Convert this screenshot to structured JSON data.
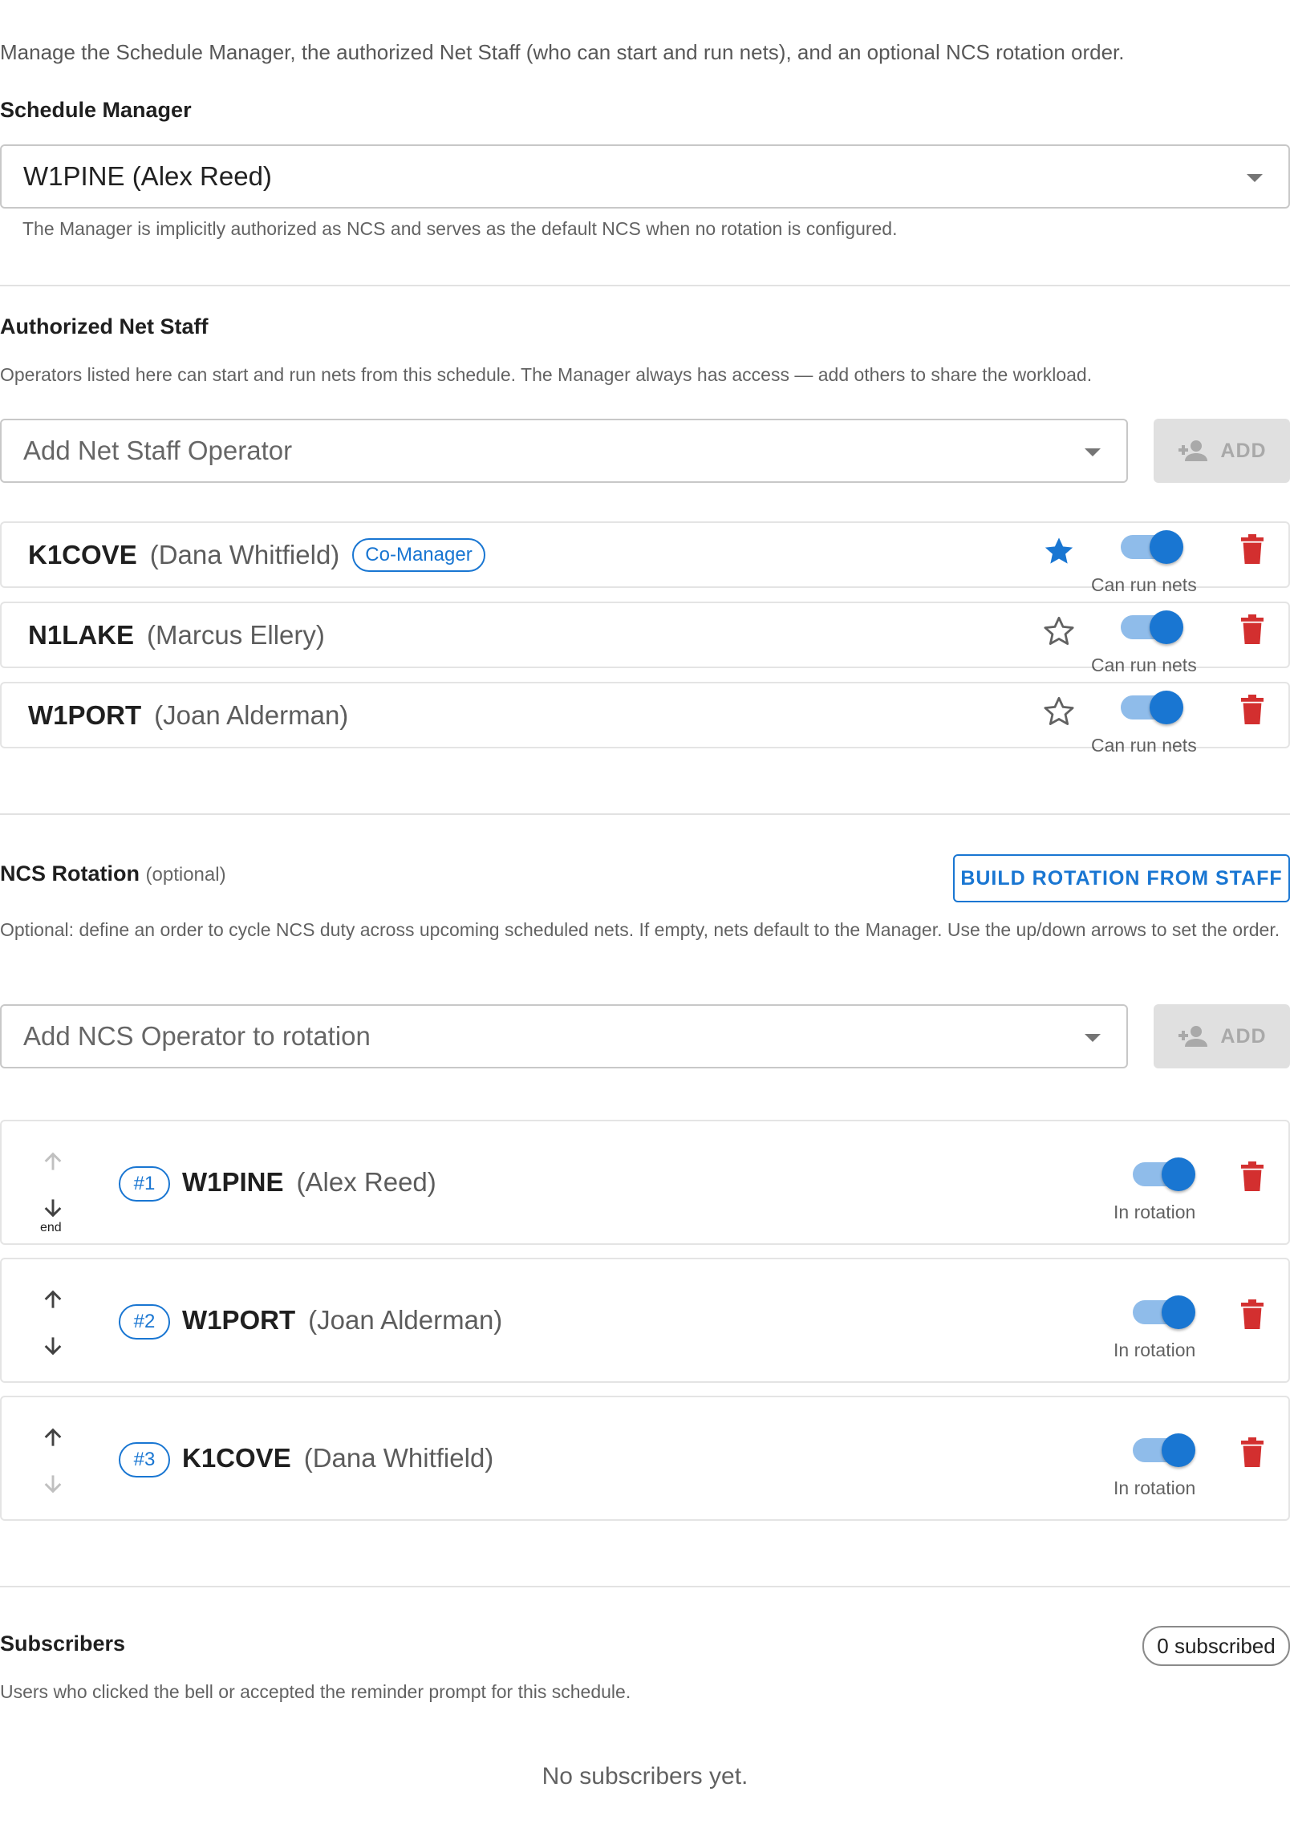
{
  "intro": "Manage the Schedule Manager, the authorized Net Staff (who can start and run nets), and an optional NCS rotation order.",
  "manager": {
    "title": "Schedule Manager",
    "selected": "W1PINE (Alex Reed)",
    "helper": "The Manager is implicitly authorized as NCS and serves as the default NCS when no rotation is configured."
  },
  "staff": {
    "title": "Authorized Net Staff",
    "description": "Operators listed here can start and run nets from this schedule. The Manager always has access — add others to share the workload.",
    "add_placeholder": "Add Net Staff Operator",
    "add_label": "ADD",
    "toggle_label": "Can run nets",
    "members": [
      {
        "callsign": "K1COVE",
        "name": "(Dana Whitfield)",
        "badge": "Co-Manager",
        "starred": true,
        "can_run": true
      },
      {
        "callsign": "N1LAKE",
        "name": "(Marcus Ellery)",
        "badge": "",
        "starred": false,
        "can_run": true
      },
      {
        "callsign": "W1PORT",
        "name": "(Joan Alderman)",
        "badge": "",
        "starred": false,
        "can_run": true
      }
    ]
  },
  "rotation": {
    "title": "NCS Rotation",
    "subtitle": "(optional)",
    "build_label": "BUILD ROTATION FROM STAFF",
    "description": "Optional: define an order to cycle NCS duty across upcoming scheduled nets. If empty, nets default to the Manager. Use the up/down arrows to set the order.",
    "add_placeholder": "Add NCS Operator to rotation",
    "add_label": "ADD",
    "toggle_label": "In rotation",
    "entries": [
      {
        "position": "#1",
        "callsign": "W1PINE",
        "name": "(Alex Reed)",
        "in_rotation": true,
        "up_enabled": false,
        "down_enabled": true
      },
      {
        "position": "#2",
        "callsign": "W1PORT",
        "name": "(Joan Alderman)",
        "in_rotation": true,
        "up_enabled": true,
        "down_enabled": true
      },
      {
        "position": "#3",
        "callsign": "K1COVE",
        "name": "(Dana Whitfield)",
        "in_rotation": true,
        "up_enabled": true,
        "down_enabled": false
      }
    ]
  },
  "subscribers": {
    "title": "Subscribers",
    "count_label": "0 subscribed",
    "description": "Users who clicked the bell or accepted the reminder prompt for this schedule.",
    "empty": "No subscribers yet."
  },
  "icons": {
    "star": "star-icon",
    "star_outline": "star-outline-icon",
    "delete": "trash-icon",
    "add_person": "person-add-icon",
    "arrow_up": "arrow-up-icon",
    "arrow_down": "arrow-down-icon",
    "dropdown": "caret-down-icon"
  },
  "colors": {
    "primary": "#1976d2",
    "toggle_track": "#8fbcea",
    "delete": "#d32f2f",
    "disabled_button": "#e0e0e0"
  }
}
